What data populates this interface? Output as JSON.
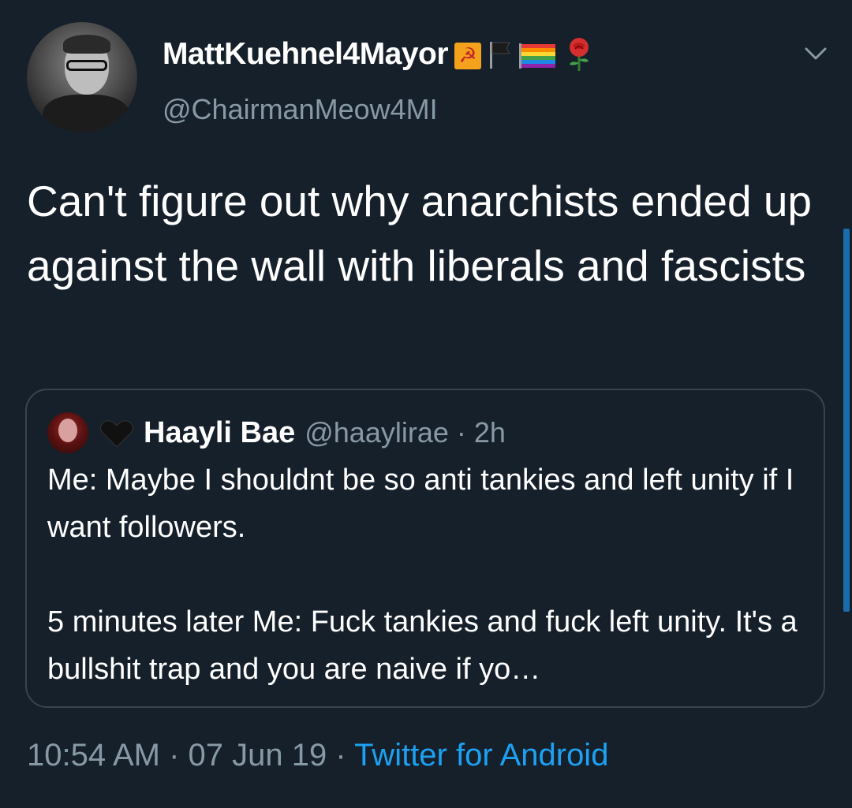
{
  "tweet": {
    "display_name": "MattKuehnel4Mayor",
    "handle": "@ChairmanMeow4MI",
    "emojis": [
      "hammer-and-sickle",
      "black-flag",
      "rainbow-flag",
      "rose"
    ],
    "hammer_glyph": "☭",
    "text": "Can't figure out why anarchists ended up against the wall with liberals and fascists",
    "timestamp": "10:54 AM · 07 Jun 19 · ",
    "source": "Twitter for Android"
  },
  "quoted_tweet": {
    "display_name": "Haayli Bae",
    "handle_time": "@haaylirae · 2h",
    "paragraph_1": "Me: Maybe I shouldnt be so anti tankies and left unity if I want followers.",
    "paragraph_2": "5 minutes later Me: Fuck tankies and fuck left unity. It's a bullshit trap and you are naive if yo…"
  },
  "colors": {
    "background": "#15202b",
    "text_primary": "#ffffff",
    "text_secondary": "#8899a6",
    "link": "#1da1f2",
    "border": "#38444d"
  }
}
